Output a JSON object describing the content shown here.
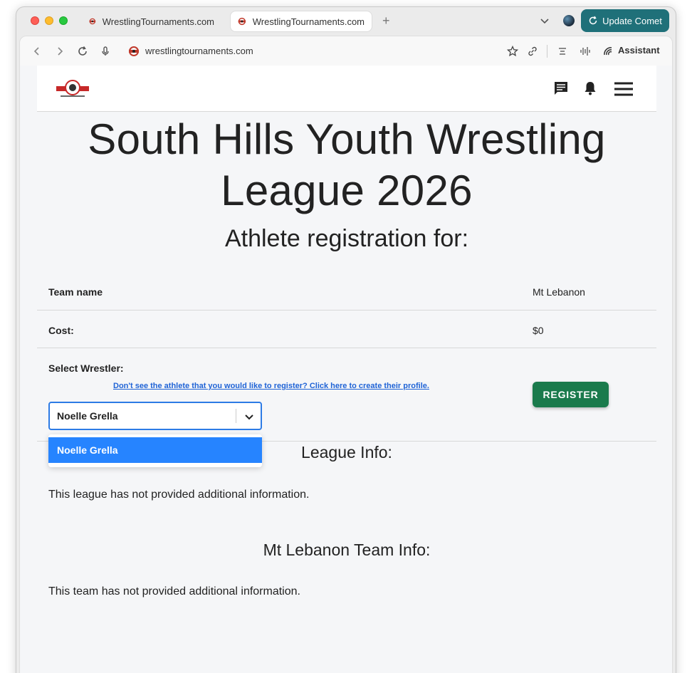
{
  "browser": {
    "tabs": [
      {
        "label": "WrestlingTournaments.com",
        "active": false
      },
      {
        "label": "WrestlingTournaments.com",
        "active": true
      }
    ],
    "update_button": "Update Comet",
    "url": "wrestlingtournaments.com",
    "assistant_label": "Assistant",
    "accent_color": "#1f7079"
  },
  "page": {
    "title": "South Hills Youth Wrestling League 2026",
    "subtitle": "Athlete registration for:",
    "team_row": {
      "label": "Team name",
      "value": "Mt Lebanon"
    },
    "cost_row": {
      "label": "Cost:",
      "value": "$0"
    },
    "wrestler": {
      "label": "Select Wrestler:",
      "create_link": "Don't see the athlete that you would like to register? Click here to create their profile.",
      "selected": "Noelle Grella",
      "options": [
        "Noelle Grella"
      ]
    },
    "register_button": "REGISTER",
    "league_info": {
      "heading": "League Info:",
      "text": "This league has not provided additional information."
    },
    "team_info": {
      "heading": "Mt Lebanon Team Info:",
      "text": "This team has not provided additional information."
    },
    "colors": {
      "register": "#1a7a4c",
      "select_focus": "#2d7be5",
      "option_highlight": "#2684ff"
    }
  },
  "icons": [
    "back-icon",
    "forward-icon",
    "reload-icon",
    "mic-icon",
    "star-icon",
    "link-icon",
    "chat-icon",
    "bell-icon",
    "menu-icon"
  ]
}
